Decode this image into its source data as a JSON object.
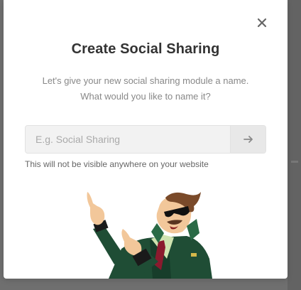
{
  "modal": {
    "title": "Create Social Sharing",
    "description": "Let's give your new social sharing module a name. What would you like to name it?",
    "close_icon": "close-icon",
    "input": {
      "value": "",
      "placeholder": "E.g. Social Sharing"
    },
    "submit_icon": "arrow-right-icon",
    "helper_text": "This will not be visible anywhere on your website",
    "mascot": "pointing-hero-illustration"
  },
  "colors": {
    "title": "#333333",
    "description": "#888888",
    "input_bg": "#f2f2f2",
    "button_bg": "#e8e8e8",
    "backdrop": "#6f6f6f"
  }
}
